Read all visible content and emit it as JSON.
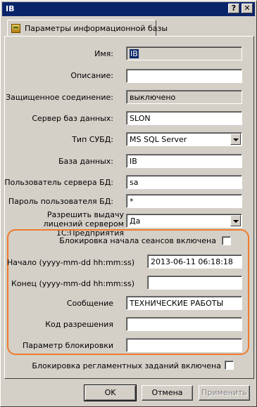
{
  "window": {
    "title": "IB",
    "help_label": "?",
    "close_label": "✕"
  },
  "tab": {
    "label": "Параметры информационной базы",
    "icon": "database-icon"
  },
  "form": {
    "name": {
      "label": "Имя:",
      "value": "IB"
    },
    "description": {
      "label": "Описание:",
      "value": ""
    },
    "secure": {
      "label": "Защищенное соединение:",
      "value": "выключено"
    },
    "db_server": {
      "label": "Сервер баз данных:",
      "value": "SLON"
    },
    "dbms_type": {
      "label": "Тип СУБД:",
      "value": "MS SQL Server"
    },
    "database": {
      "label": "База данных:",
      "value": "IB"
    },
    "db_user": {
      "label": "Пользователь сервера БД:",
      "value": "sa"
    },
    "db_password": {
      "label": "Пароль пользователя БД:",
      "value": "*"
    },
    "licenses": {
      "label": "Разрешить выдачу лицензий сервером 1С:Предприятия",
      "value": "Да"
    },
    "session_lock": {
      "label": "Блокировка начала сеансов включена",
      "checked": false
    },
    "start": {
      "label": "Начало (yyyy-mm-dd hh:mm:ss)",
      "value": "2013-06-11 06:18:18"
    },
    "end": {
      "label": "Конец (yyyy-mm-dd hh:mm:ss)",
      "value": ""
    },
    "message": {
      "label": "Сообщение",
      "value": "ТЕХНИЧЕСКИЕ РАБОТЫ"
    },
    "permission_code": {
      "label": "Код разрешения",
      "value": ""
    },
    "lock_param": {
      "label": "Параметр блокировки",
      "value": ""
    },
    "scheduled_lock": {
      "label": "Блокировка регламентных заданий включена",
      "checked": false
    }
  },
  "buttons": {
    "ok": "OK",
    "cancel": "Отмена",
    "apply": "Применить"
  },
  "colors": {
    "highlight_frame": "#f07a2a",
    "titlebar": "#0a246a",
    "face": "#d4d0c8"
  }
}
